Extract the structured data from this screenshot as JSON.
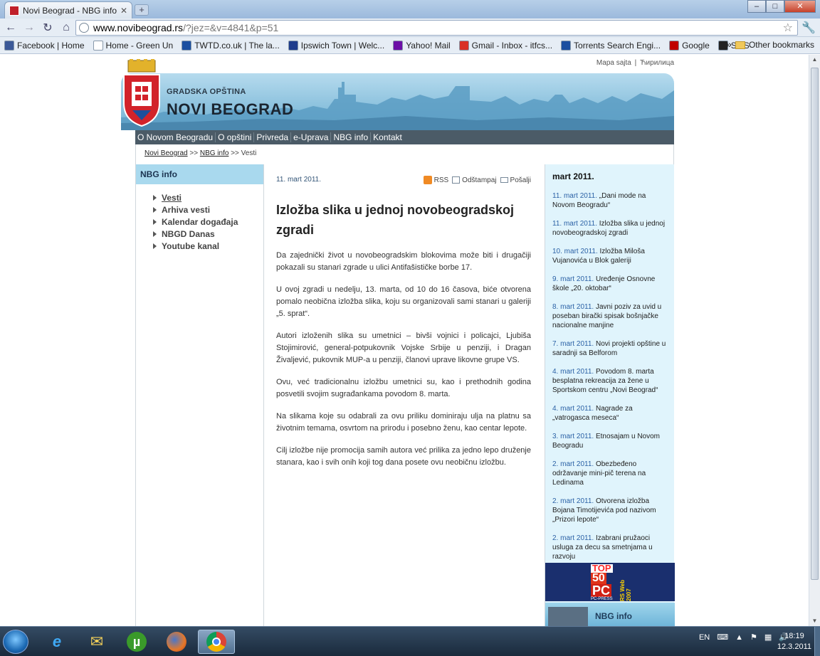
{
  "browser": {
    "tab_title": "Novi Beograd - NBG info",
    "url_host": "www.novibeograd.rs",
    "url_path": "/?jez=&v=4841&p=51"
  },
  "bookmarks": [
    {
      "label": "Facebook | Home",
      "icon": "facebook-icon",
      "color": "#3b5998"
    },
    {
      "label": "Home - Green Un",
      "icon": "page-icon",
      "color": "#ffffff"
    },
    {
      "label": "TWTD.co.uk | The la...",
      "icon": "twtd-icon",
      "color": "#1b4fa0"
    },
    {
      "label": "Ipswich Town | Welc...",
      "icon": "ipswich-icon",
      "color": "#1e3c8c"
    },
    {
      "label": "Yahoo! Mail",
      "icon": "yahoo-icon",
      "color": "#6b0fa6"
    },
    {
      "label": "Gmail - Inbox - itfcs...",
      "icon": "gmail-icon",
      "color": "#d93025"
    },
    {
      "label": "Torrents Search Engi...",
      "icon": "torrents-icon",
      "color": "#1b4fa0"
    },
    {
      "label": "Google",
      "icon": "youtube-icon",
      "color": "#c00000"
    },
    {
      "label": "SMS",
      "icon": "mybtn-icon",
      "color": "#222222"
    }
  ],
  "other_bookmarks": "Other bookmarks",
  "site": {
    "toplinks": [
      "Mapa sajta",
      "|",
      "Ћирилица"
    ],
    "brand_small": "GRADSKA OPŠTINA",
    "brand_big": "NOVI BEOGRAD",
    "nav": [
      "O Novom Beogradu",
      "O opštini",
      "Privreda",
      "e-Uprava",
      "NBG info",
      "Kontakt"
    ],
    "breadcrumb": {
      "crumb1": "Novi Beograd",
      "sep1": ">>",
      "crumb2": "NBG info",
      "sep2": ">>",
      "current": "Vesti"
    },
    "left_head": "NBG info",
    "left_menu": [
      "Vesti",
      "Arhiva vesti",
      "Kalendar događaja",
      "NBGD Danas",
      "Youtube kanal"
    ],
    "article": {
      "date": "11. mart 2011.",
      "rss": "RSS",
      "print": "Odštampaj",
      "send": "Pošalji",
      "title": "Izložba slika u jednoj novobeogradskoj zgradi",
      "paragraphs": [
        "Da zajednički život u novobeogradskim blokovima može biti i drugačiji pokazali su stanari zgrade u ulici Antifašističke borbe 17.",
        "U ovoj zgradi u nedelju, 13. marta, od 10 do 16 časova, biće otvorena pomalo neobična izložba slika, koju su organizovali sami stanari u galeriji „5. sprat“.",
        "Autori izloženih slika su umetnici – bivši vojnici i policajci, Ljubiša Stojimirović, general-potpukovnik Vojske Srbije u penziji, i Dragan Živaljević, pukovnik MUP-a u penziji, članovi uprave likovne grupe VS.",
        "Ovu, već tradicionalnu izložbu umetnici su, kao i prethodnih godina posvetili svojim sugrađankama povodom 8. marta.",
        "Na slikama koje su odabrali za ovu priliku dominiraju ulja na platnu sa životnim temama, osvrtom na prirodu i posebno ženu, kao centar lepote.",
        "Cilj izložbe nije promocija samih autora već prilika za jedno lepo druženje stanara, kao i svih onih koji tog dana posete ovu neobičnu izložbu."
      ]
    },
    "right_head": "mart 2011.",
    "news": [
      {
        "date": "11. mart 2011.",
        "text": "„Dani mode na Novom Beogradu“"
      },
      {
        "date": "11. mart 2011.",
        "text": "Izložba slika u jednoj novobeogradskoj zgradi"
      },
      {
        "date": "10. mart 2011.",
        "text": "Izložba Miloša Vujanovića u Blok galeriji"
      },
      {
        "date": "9. mart 2011.",
        "text": "Uređenje Osnovne škole „20. oktobar“"
      },
      {
        "date": "8. mart 2011.",
        "text": "Javni poziv za uvid u poseban birački spisak bošnjačke nacionalne manjine"
      },
      {
        "date": "7. mart 2011.",
        "text": "Novi projekti opštine u saradnji sa Belforom"
      },
      {
        "date": "4. mart 2011.",
        "text": "Povodom 8. marta besplatna rekreacija za žene u Sportskom centru „Novi Beograd“"
      },
      {
        "date": "4. mart 2011.",
        "text": "Nagrade za „vatrogasca meseca“"
      },
      {
        "date": "3. mart 2011.",
        "text": "Etnosajam u Novom Beogradu"
      },
      {
        "date": "2. mart 2011.",
        "text": "Obezbeđeno održavanje mini-pič terena na Ledinama"
      },
      {
        "date": "2. mart 2011.",
        "text": "Otvorena izložba Bojana Timotijevića pod nazivom „Prizori lepote“"
      },
      {
        "date": "2. mart 2011.",
        "text": "Izabrani pružaoci usluga za decu sa smetnjama u razvoju"
      }
    ],
    "ad_top50": {
      "line1": "TOP",
      "line2": "50",
      "line3": "PC",
      "line4": "PC-PRESS",
      "side": "RS Web 2007"
    },
    "ad_nbg": "NBG info"
  },
  "taskbar": {
    "apps": [
      "explorer-icon",
      "outlook-icon",
      "utorrent-icon",
      "firefox-icon",
      "chrome-icon"
    ],
    "language": "EN",
    "time": "18:19",
    "date": "12.3.2011"
  },
  "colors": {
    "nav_bg": "#4b5b67",
    "left_head_bg": "#a9d9ee",
    "right_bg": "#e0f4fc",
    "link_blue": "#2c62a6"
  }
}
